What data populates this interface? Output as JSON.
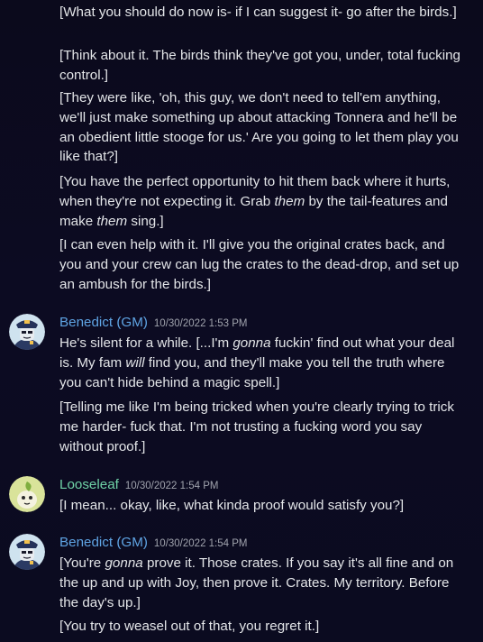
{
  "colors": {
    "background": "#0c0b22",
    "text": "#e3e5e8",
    "gm_name": "#5fa4e4",
    "leaf_name": "#6fd1a6",
    "timestamp": "#a0a3ad"
  },
  "continued_messages": [
    {
      "text": "[What you should do now is- if I can suggest it- go after the birds.]"
    },
    {
      "text": "[Think about it. The birds think they've got you, under, total fucking control.]"
    },
    {
      "text": "[They were like, 'oh, this guy, we don't need to tell'em anything, we'll just make something up about attacking Tonnera and he'll be an obedient little stooge for us.' Are you going to let them play you like that?]"
    },
    {
      "parts": [
        "[You have the perfect opportunity to hit them back where it hurts, when they're not expecting it. Grab ",
        "them",
        " by the tail-features and make ",
        "them",
        " sing.]"
      ]
    },
    {
      "text": "[I can even help with it. I'll give you the original crates back, and you and your crew can lug the crates to the dead-drop, and set up an ambush for the birds.]"
    }
  ],
  "groups": [
    {
      "author": "Benedict (GM)",
      "avatar_icon": "police-officer-avatar-icon",
      "timestamp": "10/30/2022 1:53 PM",
      "messages": [
        {
          "parts": [
            "He's silent for a while. [...I'm ",
            "gonna",
            " fuckin' find out what your deal is. My fam ",
            "will",
            " find you, and they'll make you tell the truth where you can't hide behind a magic spell.]"
          ]
        },
        {
          "text": "[Telling me like I'm being tricked when you're clearly trying to trick me harder- fuck that. I'm not trusting a fucking word you say without proof.]"
        }
      ]
    },
    {
      "author": "Looseleaf",
      "avatar_icon": "leaf-creature-avatar-icon",
      "timestamp": "10/30/2022 1:54 PM",
      "messages": [
        {
          "text": "[I mean... okay, like, what kinda proof would satisfy you?]"
        }
      ]
    },
    {
      "author": "Benedict (GM)",
      "avatar_icon": "police-officer-avatar-icon",
      "timestamp": "10/30/2022 1:54 PM",
      "messages": [
        {
          "parts": [
            "[You're ",
            "gonna",
            " prove it. Those crates. If you say it's all fine and on the up and up with Joy, then prove it. Crates. My territory. Before the day's up.]"
          ]
        },
        {
          "text": "[You try to weasel out of that, you regret it.]"
        }
      ]
    }
  ]
}
